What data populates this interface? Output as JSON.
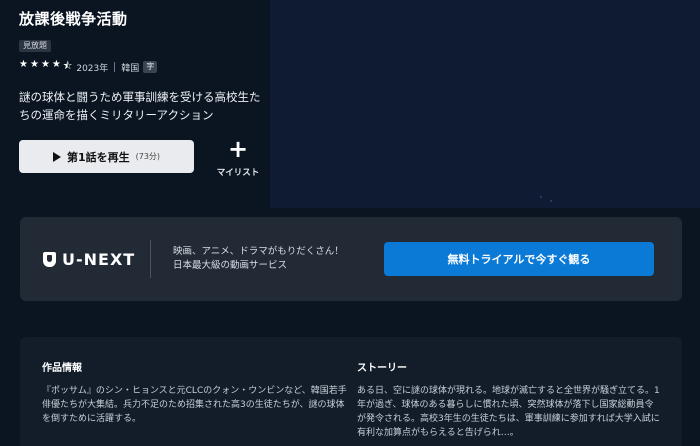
{
  "hero": {
    "title": "放課後戦争活動",
    "badge": "見放題",
    "rating_stars": 4.5,
    "year": "2023年",
    "country": "韓国",
    "subtitle_tag": "字",
    "description": "謎の球体と闘うため軍事訓練を受ける高校生たちの運命を描くミリタリーアクション",
    "play_label": "第1話を再生",
    "play_duration": "(73分)",
    "mylist_label": "マイリスト"
  },
  "promo": {
    "logo_text": "U-NEXT",
    "line1": "映画、アニメ、ドラマがもりだくさん！",
    "line2": "日本最大級の動画サービス",
    "cta_label": "無料トライアルで今すぐ観る"
  },
  "info": {
    "works_heading": "作品情報",
    "works_text": "『ポッサム』のシン・ヒョンスと元CLCのクォン・ウンビンなど、韓国若手俳優たちが大集結。兵力不足のため招集された高3の生徒たちが、謎の球体を倒すために活躍する。",
    "story_heading": "ストーリー",
    "story_text": "ある日、空に謎の球体が現れる。地球が滅亡すると全世界が騒ぎ立てる。1年が過ぎ、球体のある暮らしに慣れた頃、突然球体が落下し国家総動員令が発令される。高校3年生の生徒たちは、軍事訓練に参加すれば大学入試に有利な加算点がもらえると告げられ…。"
  },
  "colors": {
    "background": "#0b1522",
    "cta": "#0a7ad6",
    "promo_bg": "#212a35"
  }
}
